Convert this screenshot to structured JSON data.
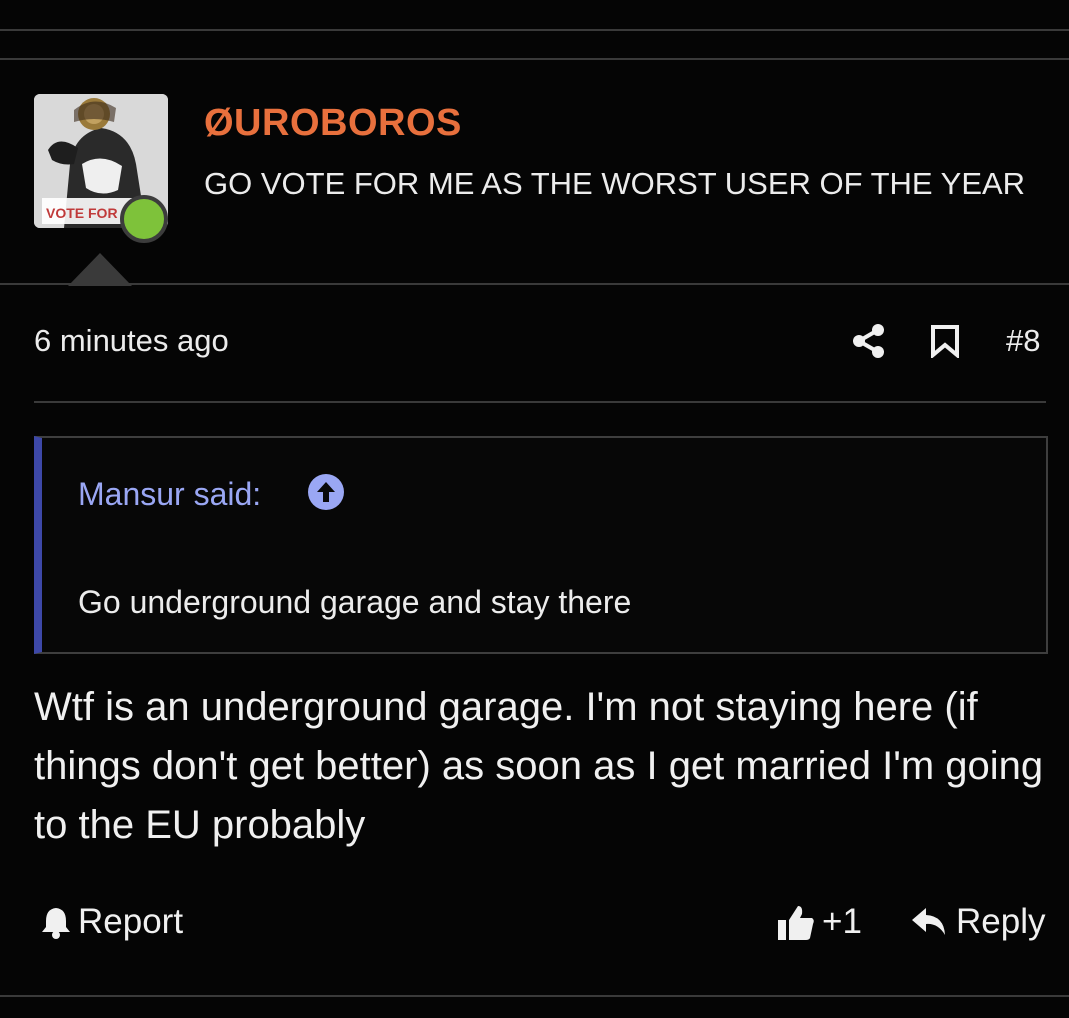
{
  "user": {
    "name": "ØUROBOROS",
    "title": "GO VOTE FOR ME AS THE WORST USER OF THE YEAR",
    "avatar_text": "VOTE FOR M",
    "online_color": "#7ec23a"
  },
  "meta": {
    "timestamp": "6 minutes ago",
    "post_number": "#8",
    "share_icon": "share-icon",
    "bookmark_icon": "bookmark-icon"
  },
  "quote": {
    "author": "Mansur said:",
    "text": "Go underground garage and stay there",
    "accent_color": "#3d48a8"
  },
  "post": {
    "body": "Wtf is an underground garage. I'm not staying here (if things don't get better) as soon as I get married I'm going to the EU probably"
  },
  "actions": {
    "report_label": "Report",
    "like_count": "+1",
    "reply_label": "Reply"
  }
}
